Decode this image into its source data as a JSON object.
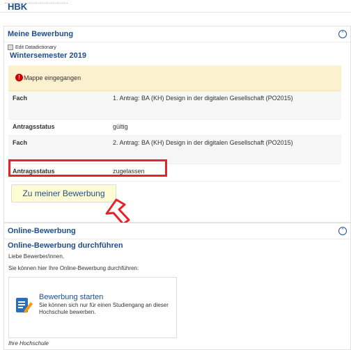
{
  "header": {
    "title": "HBK"
  },
  "application_panel": {
    "title": "Meine Bewerbung",
    "edit_datadictionary": "Edit Datadictionary",
    "semester": "Wintersemester 2019",
    "alert_text": "Mappe eingegangen",
    "rows": [
      {
        "key": "Fach",
        "value": "1. Antrag: BA (KH) Design in der digitalen Gesellschaft (PO2015)"
      },
      {
        "key": "Antragsstatus",
        "value": "gültig"
      },
      {
        "key": "Fach",
        "value": "2. Antrag: BA (KH) Design in der digitalen Gesellschaft (PO2015)"
      },
      {
        "key": "Antragsstatus",
        "value": "zugelassen"
      }
    ],
    "button_label": "Zu meiner Bewerbung"
  },
  "online_panel": {
    "title": "Online-Bewerbung",
    "subtitle": "Online-Bewerbung durchführen",
    "greeting": "Liebe Bewerber/innen,",
    "intro": "Sie können hier Ihre Online-Bewerbung durchführen:",
    "start_title": "Bewerbung starten",
    "start_desc": "Sie können sich nur für einen Studiengang an dieser Hochschule bewerben.",
    "university_label": "Ihre Hochschule"
  },
  "icons": {
    "collapse": "chevron-up-icon",
    "alert": "exclamation-icon",
    "start": "edit-form-icon",
    "annotation": "red-arrow-icon"
  },
  "colors": {
    "heading_blue": "#1e4f8a",
    "alert_bg": "#fcf1cf",
    "highlight_red": "#e52329",
    "button_bg": "#fffbd3",
    "start_icon_blue": "#2a6ebb",
    "start_icon_orange": "#f39c12"
  }
}
